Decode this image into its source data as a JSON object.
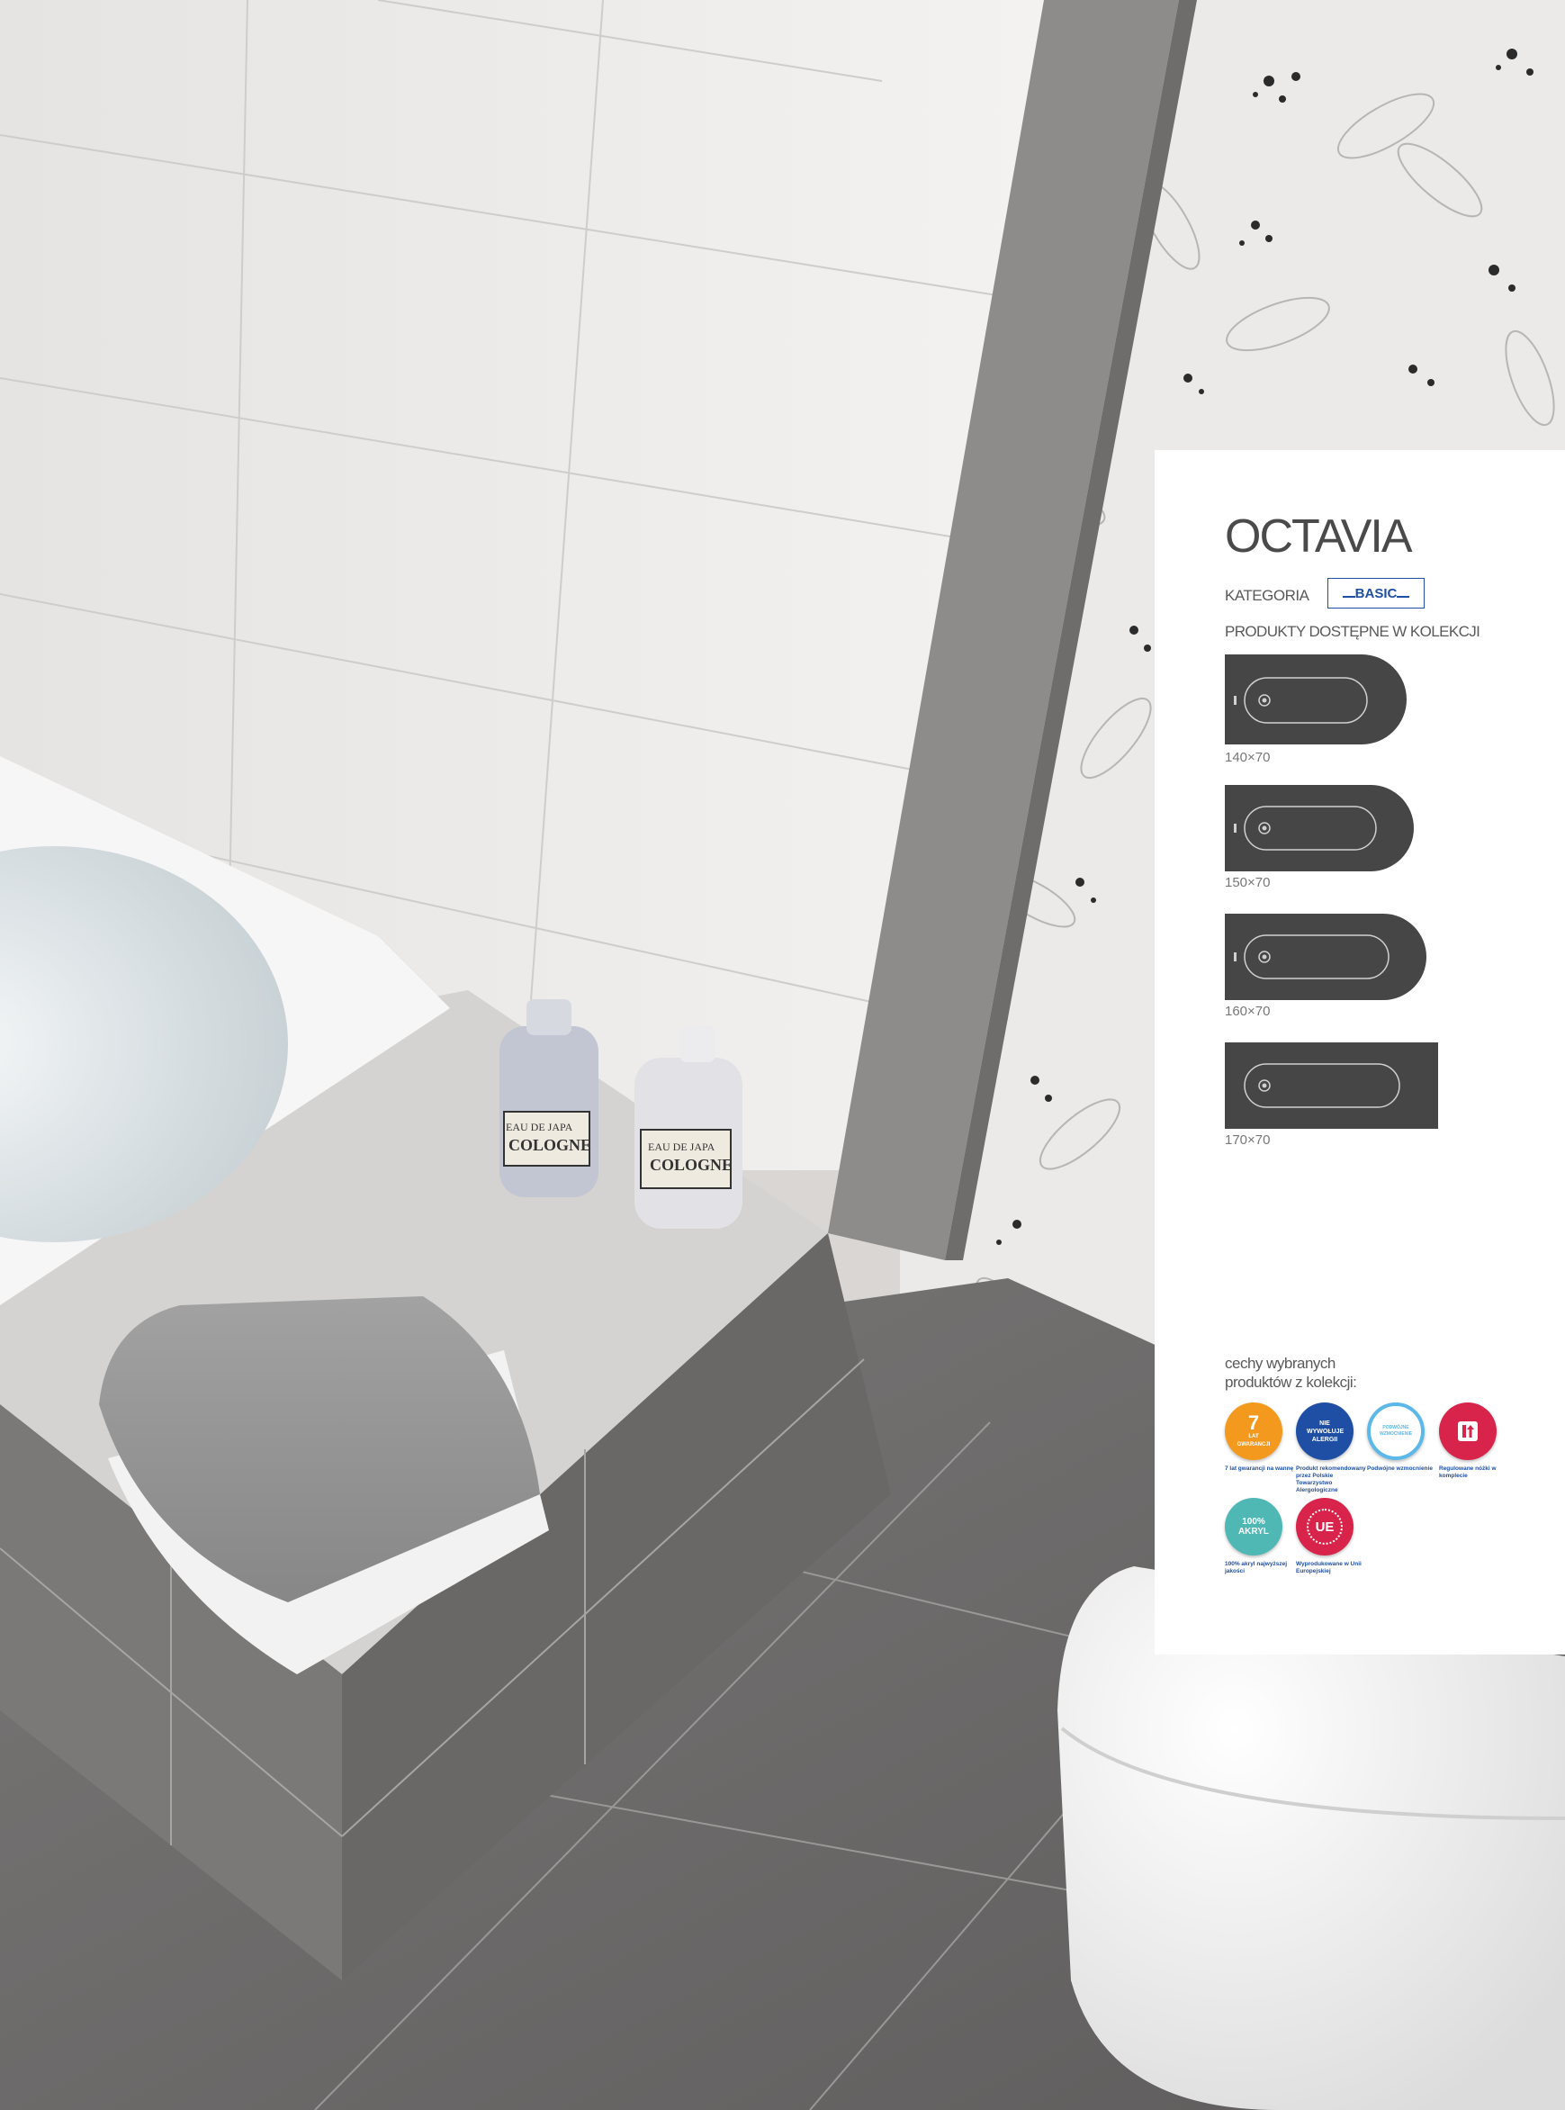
{
  "product": {
    "name": "OCTAVIA",
    "category_label": "KATEGORIA",
    "category_value": "BASIC",
    "products_label": "PRODUKTY DOSTĘPNE W KOLEKCJI",
    "sizes": [
      "140×70",
      "150×70",
      "160×70",
      "170×70"
    ]
  },
  "features": {
    "label": "cechy wybranych produktów z kolekcji:",
    "items": [
      {
        "icon": "warranty-7-years-icon",
        "badge_number": "7",
        "badge_text": "LAT GWARANCJI",
        "caption": "7 lat gwarancji na wannę",
        "color": "#f39a1e"
      },
      {
        "icon": "no-allergy-icon",
        "badge_text": "NIE WYWOŁUJE ALERGII",
        "caption": "Produkt rekomendowany przez Polskie Towarzystwo Alergologiczne",
        "color": "#1f4fa5"
      },
      {
        "icon": "double-reinforcement-icon",
        "badge_text": "PODWÓJNE WZMOCNIENIE",
        "caption": "Podwójne wzmocnienie",
        "color": "#5bb8e8"
      },
      {
        "icon": "adjustable-legs-icon",
        "caption": "Regulowane nóżki w komplecie",
        "color": "#d8234a"
      },
      {
        "icon": "acrylic-100-icon",
        "badge_text": "100% AKRYL",
        "caption": "100% akryl najwyższej jakości",
        "color": "#4fb8b5"
      },
      {
        "icon": "eu-made-icon",
        "badge_text": "UE",
        "caption": "Wyprodukowane w Unii Europejskiej",
        "color": "#d8234a"
      }
    ]
  },
  "scene": {
    "bottle_label_line1": "EAU DE JAPA",
    "bottle_label_line2": "COLOGNE"
  }
}
